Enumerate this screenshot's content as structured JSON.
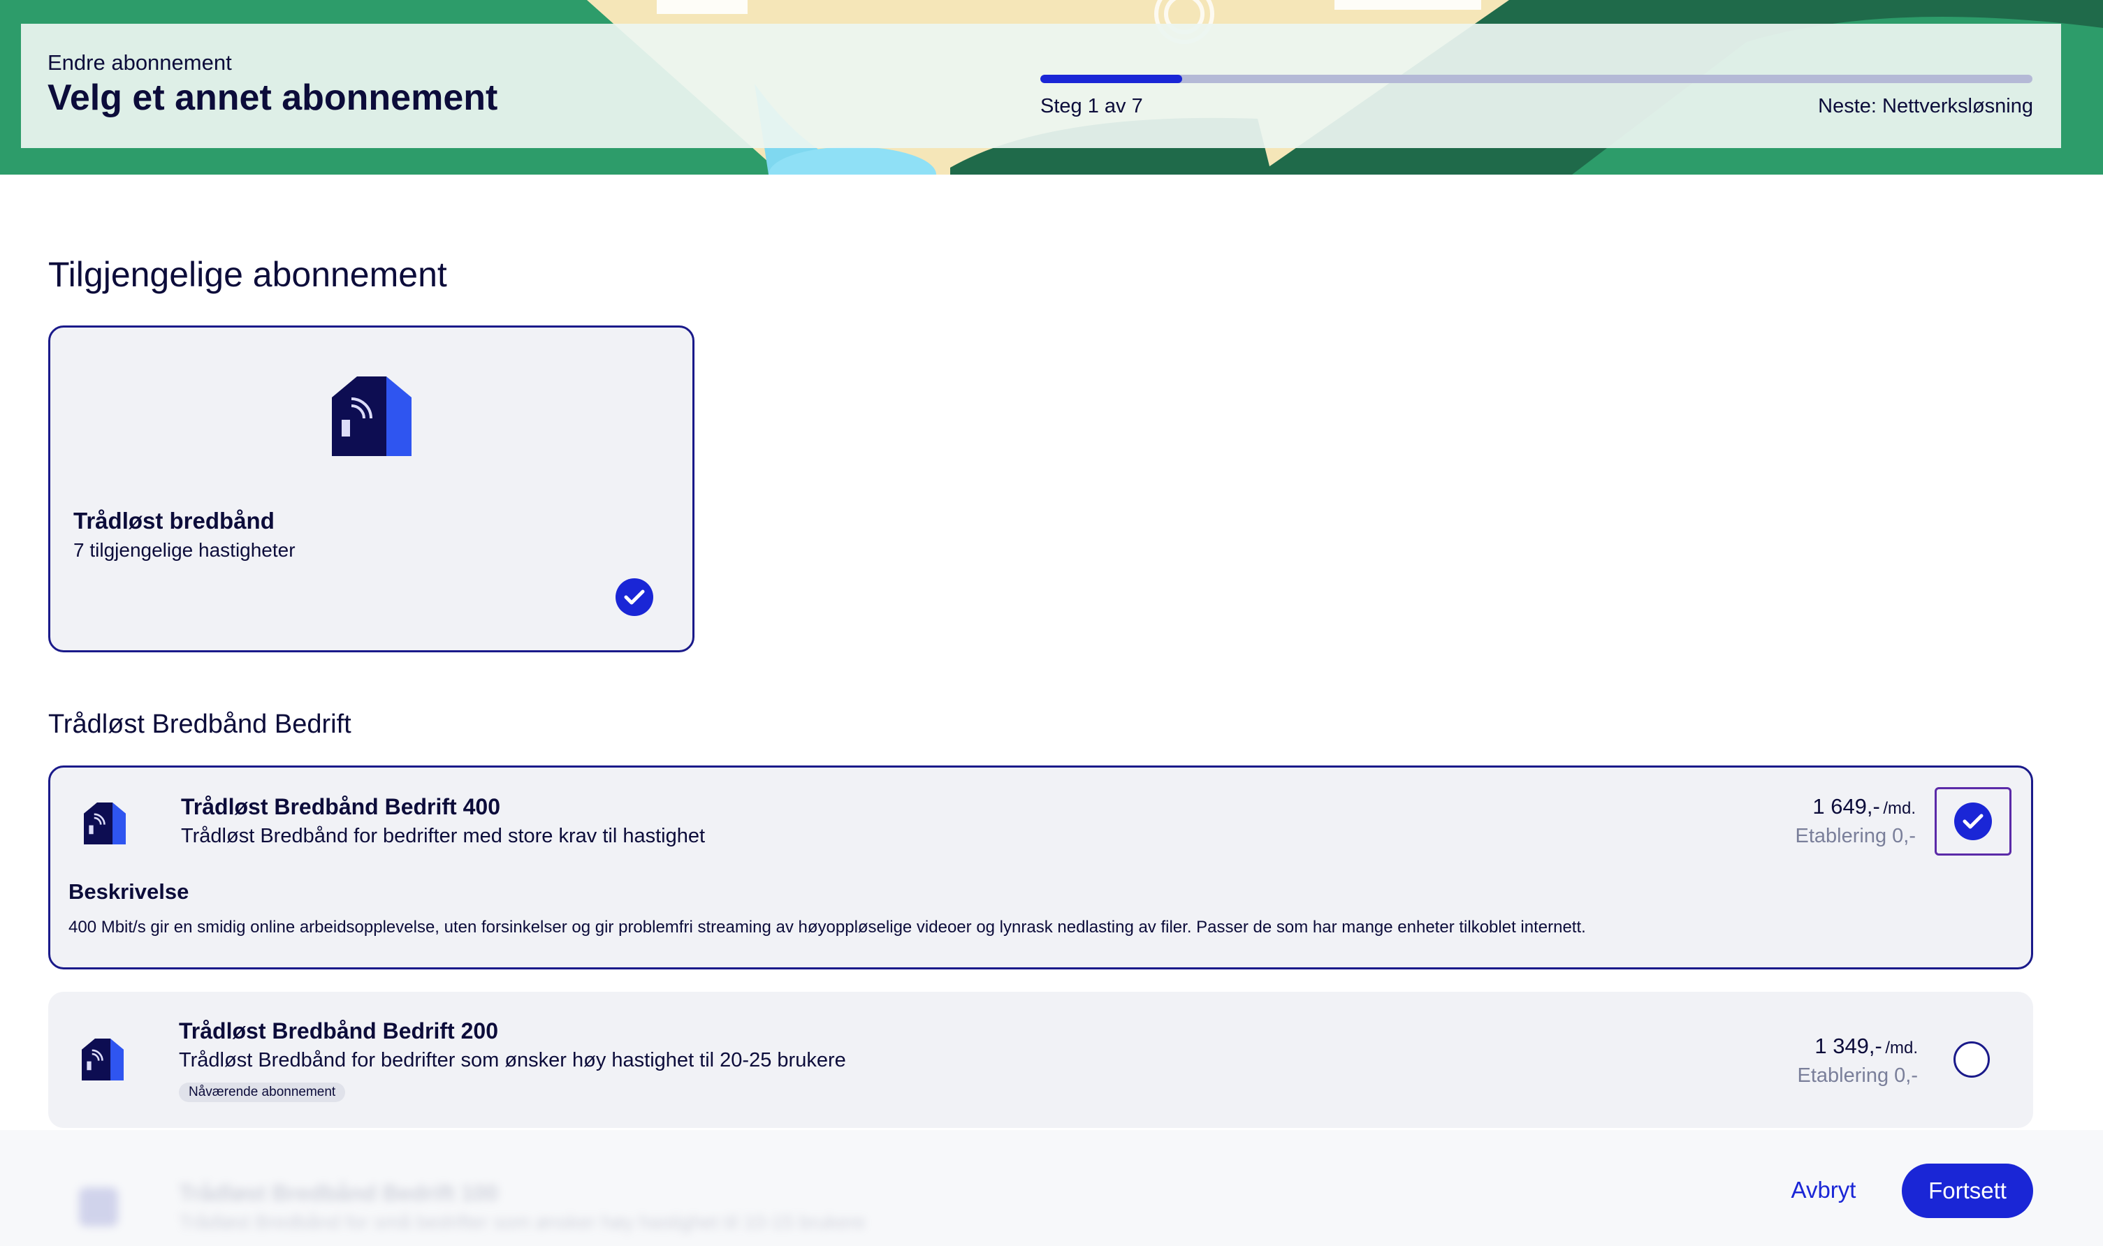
{
  "header": {
    "subtitle": "Endre abonnement",
    "title": "Velg et annet abonnement",
    "progress_fraction": 0.143,
    "step_label": "Steg 1 av 7",
    "next_label": "Neste: Nettverksløsning"
  },
  "section_title": "Tilgjengelige abonnement",
  "category": {
    "name": "Trådløst bredbånd",
    "count": "7 tilgjengelige hastigheter",
    "icon": "wireless-house-icon",
    "selected": true
  },
  "group_title": "Trådløst Bredbånd Bedrift",
  "products": [
    {
      "name": "Trådløst Bredbånd Bedrift 400",
      "description": "Trådløst Bredbånd for bedrifter med store krav til hastighet",
      "price": "1 649,-",
      "price_unit": "/md.",
      "setup": "Etablering 0,-",
      "selected": true,
      "details_heading": "Beskrivelse",
      "details_text": "400 Mbit/s gir en smidig online arbeidsopplevelse, uten forsinkelser og gir problemfri streaming av høyoppløselige videoer og lynrask nedlasting av filer. Passer de som har mange enheter tilkoblet internett."
    },
    {
      "name": "Trådløst Bredbånd Bedrift 200",
      "description": "Trådløst Bredbånd for bedrifter som ønsker høy hastighet til 20-25 brukere",
      "price": "1 349,-",
      "price_unit": "/md.",
      "setup": "Etablering 0,-",
      "selected": false,
      "badge": "Nåværende abonnement"
    },
    {
      "name": "Trådløst Bredbånd Bedrift 100",
      "description": "Trådløst Bredbånd for små bedrifter som ønsker høy hastighet til 10-15 brukere",
      "obscured": true
    }
  ],
  "footer": {
    "cancel_label": "Avbryt",
    "continue_label": "Fortsett"
  },
  "colors": {
    "accent": "#1a26d6",
    "navy": "#0c0c3a",
    "banner_green": "#2d9c6a",
    "card_bg": "#f1f2f6"
  }
}
